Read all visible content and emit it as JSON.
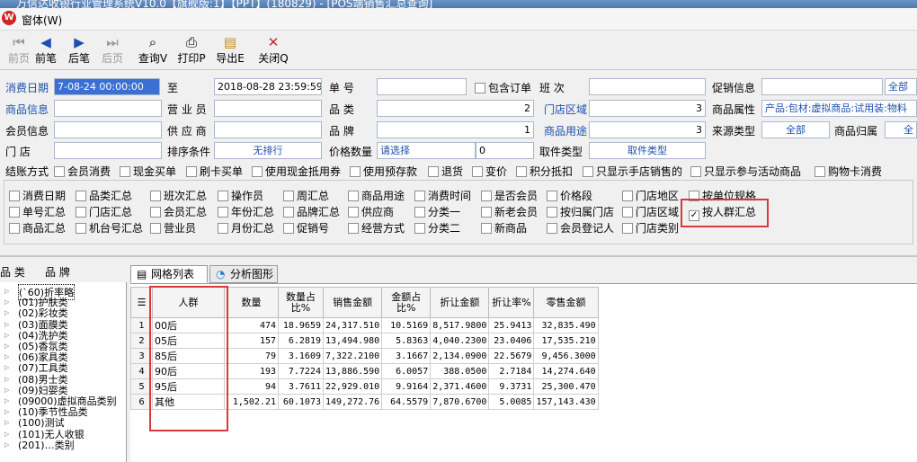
{
  "window": {
    "title": "万信达收银行业管理系统V10.0【旗舰版:1】【PPT】(180829) - [POS端销售汇总查询]",
    "menu": "窗体(W)"
  },
  "toolbar": [
    {
      "label": "前页",
      "icon": "⏮",
      "enabled": false
    },
    {
      "label": "前笔",
      "icon": "◀",
      "enabled": true
    },
    {
      "label": "后笔",
      "icon": "▶",
      "enabled": true
    },
    {
      "label": "后页",
      "icon": "⏭",
      "enabled": false
    },
    {
      "label": "查询V",
      "icon": "🔍",
      "enabled": true
    },
    {
      "label": "打印P",
      "icon": "🖶",
      "enabled": true
    },
    {
      "label": "导出E",
      "icon": "📂",
      "enabled": true
    },
    {
      "label": "关闭Q",
      "icon": "✕",
      "enabled": true
    }
  ],
  "filters": {
    "consume_date_label": "消费日期",
    "date_from": "7-08-24 00:00:00",
    "to_label": "至",
    "date_to": "2018-08-28 23:59:59",
    "doc_no_label": "单    号",
    "include_order": "包含订单",
    "shift_label": "班    次",
    "promo_info_label": "促销信息",
    "promo_info_value": "全部",
    "goods_info_label": "商品信息",
    "salesperson_label": "营 业 员",
    "category_label": "品    类",
    "category_value": "2",
    "store_area_label": "门店区域",
    "store_area_value": "3",
    "goods_attr_label": "商品属性",
    "goods_attr_value": "产品:包材:虚拟商品:试用装:物料",
    "member_info_label": "会员信息",
    "supplier_label": "供 应 商",
    "brand_label": "品    牌",
    "brand_value": "1",
    "store_use_label": "商品用途",
    "store_use_value": "3",
    "source_type_label": "来源类型",
    "source_type_value": "全部",
    "goods_owner_label": "商品归属",
    "goods_owner_value": "全",
    "store_label": "门    店",
    "sort_label": "排序条件",
    "sort_value": "无排行",
    "price_qty_label": "价格数量",
    "price_qty_value": "请选择",
    "price_qty_num": "0",
    "doc_type_label": "取件类型",
    "doc_type_value": "取件类型"
  },
  "settlement": {
    "label": "结账方式",
    "options": [
      "会员消费",
      "现金买单",
      "刷卡买单",
      "使用现金抵用券",
      "使用预存款",
      "退货",
      "变价",
      "积分抵扣",
      "只显示手店销售的",
      "只显示参与活动商品",
      "购物卡消费"
    ]
  },
  "summary_options": [
    [
      "消费日期",
      "品类汇总",
      "班次汇总",
      "操作员",
      "周汇总",
      "商品用途",
      "消费时间",
      "是否会员",
      "价格段",
      "门店地区",
      "按单位规格"
    ],
    [
      "单号汇总",
      "门店汇总",
      "会员汇总",
      "年份汇总",
      "品牌汇总",
      "供应商",
      "分类一",
      "新老会员",
      "按归属门店",
      "门店区域",
      "按人群汇总"
    ],
    [
      "商品汇总",
      "机台号汇总",
      "营业员",
      "月份汇总",
      "促销号",
      "经营方式",
      "分类二",
      "新商品",
      "会员登记人",
      "门店类别",
      ""
    ]
  ],
  "checked_option": "按人群汇总",
  "left_tabs": [
    "品 类",
    "品 牌"
  ],
  "tree": [
    "(`60)折率略",
    "(01)护肤类",
    "(02)彩妆类",
    "(03)面膜类",
    "(04)洗护类",
    "(05)香氛类",
    "(06)家具类",
    "(07)工具类",
    "(08)男士类",
    "(09)妇婴类",
    "(09000)虚拟商品类别",
    "(10)季节性品类",
    "(100)测试",
    "(101)无人收银",
    "(201)…类别"
  ],
  "tabs": [
    "网格列表",
    "分析图形"
  ],
  "grid": {
    "headers": [
      "人群",
      "数量",
      "数量占比%",
      "销售金额",
      "金额占比%",
      "折让金额",
      "折让率%",
      "零售金额"
    ],
    "rows": [
      [
        "1",
        "00后",
        "474",
        "18.9659",
        "24,317.510",
        "10.5169",
        "8,517.9800",
        "25.9413",
        "32,835.490"
      ],
      [
        "2",
        "05后",
        "157",
        "6.2819",
        "13,494.980",
        "5.8363",
        "4,040.2300",
        "23.0406",
        "17,535.210"
      ],
      [
        "3",
        "85后",
        "79",
        "3.1609",
        "7,322.2100",
        "3.1667",
        "2,134.0900",
        "22.5679",
        "9,456.3000"
      ],
      [
        "4",
        "90后",
        "193",
        "7.7224",
        "13,886.590",
        "6.0057",
        "388.0500",
        "2.7184",
        "14,274.640"
      ],
      [
        "5",
        "95后",
        "94",
        "3.7611",
        "22,929.010",
        "9.9164",
        "2,371.4600",
        "9.3731",
        "25,300.470"
      ],
      [
        "6",
        "其他",
        "1,502.21",
        "60.1073",
        "149,272.76",
        "64.5579",
        "7,870.6700",
        "5.0085",
        "157,143.430"
      ]
    ]
  },
  "colors": {
    "accent": "#1b4fb0",
    "highlight": "#d83a3a",
    "title": "#4c78b0"
  }
}
